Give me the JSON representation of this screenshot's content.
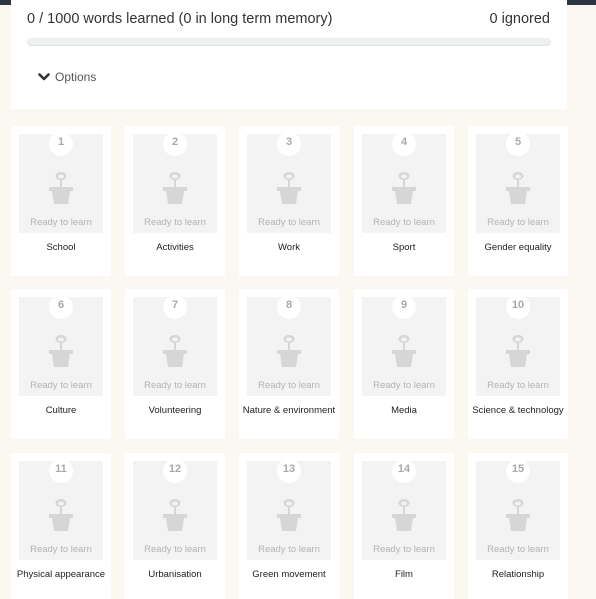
{
  "progress": {
    "summary": "0 / 1000 words learned (0 in long term memory)",
    "ignored": "0 ignored",
    "fraction": 0
  },
  "options": {
    "label": "Options",
    "icon": "chevron-down-icon"
  },
  "ready_label": "Ready to learn",
  "courses": [
    {
      "number": "1",
      "title": "School",
      "status": "Ready to learn"
    },
    {
      "number": "2",
      "title": "Activities",
      "status": "Ready to learn"
    },
    {
      "number": "3",
      "title": "Work",
      "status": "Ready to learn"
    },
    {
      "number": "4",
      "title": "Sport",
      "status": "Ready to learn"
    },
    {
      "number": "5",
      "title": "Gender equality",
      "status": "Ready to learn"
    },
    {
      "number": "6",
      "title": "Culture",
      "status": "Ready to learn"
    },
    {
      "number": "7",
      "title": "Volunteering",
      "status": "Ready to learn"
    },
    {
      "number": "8",
      "title": "Nature & environment",
      "status": "Ready to learn"
    },
    {
      "number": "9",
      "title": "Media",
      "status": "Ready to learn"
    },
    {
      "number": "10",
      "title": "Science & technology",
      "status": "Ready to learn"
    },
    {
      "number": "11",
      "title": "Physical appearance",
      "status": "Ready to learn"
    },
    {
      "number": "12",
      "title": "Urbanisation",
      "status": "Ready to learn"
    },
    {
      "number": "13",
      "title": "Green movement",
      "status": "Ready to learn"
    },
    {
      "number": "14",
      "title": "Film",
      "status": "Ready to learn"
    },
    {
      "number": "15",
      "title": "Relationship",
      "status": "Ready to learn"
    }
  ],
  "colors": {
    "page_bg": "#fbf8f2",
    "card_bg": "#ffffff",
    "thumb_bg": "#f3f3f3",
    "icon_gray": "#d6d6d6",
    "topbar": "#2c3540"
  }
}
